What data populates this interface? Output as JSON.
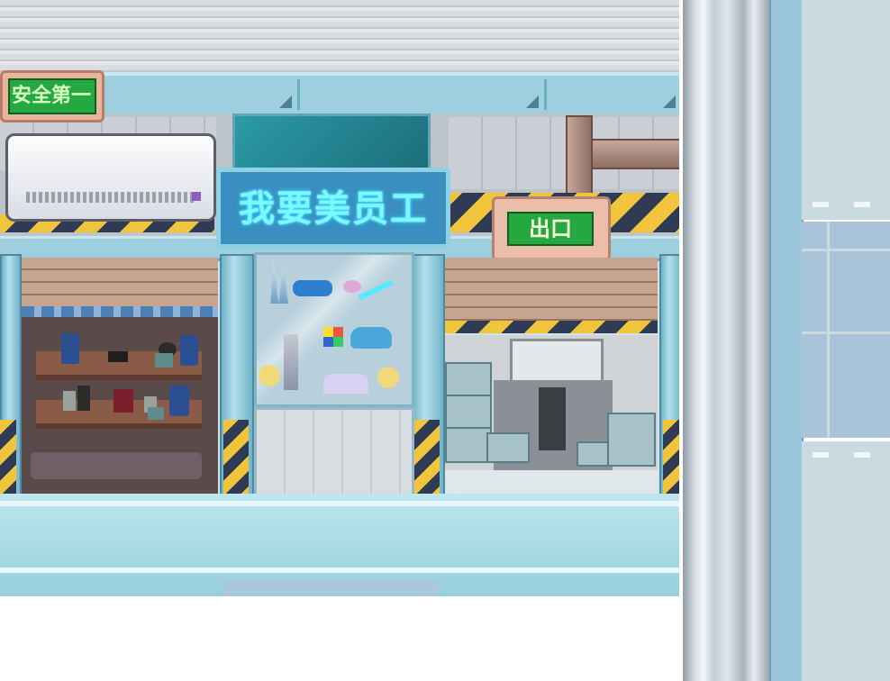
{
  "scene": {
    "safety_sign": "安全第一",
    "neon_sign": "我要美员工",
    "exit_sign": "出口"
  },
  "colors": {
    "sign_green": "#25a83f",
    "neon_cyan": "#7cf7ff",
    "hazard_yellow": "#f0c43b",
    "hazard_navy": "#2f3b55",
    "steel_blue": "#9ecfdf"
  },
  "icons": [
    "air-conditioner-icon",
    "pipe-icon",
    "rubiks-cube-icon",
    "rubber-duck-icon",
    "toy-keyboard-icon",
    "bowling-pins-icon",
    "water-gun-icon",
    "action-figure-icon"
  ]
}
